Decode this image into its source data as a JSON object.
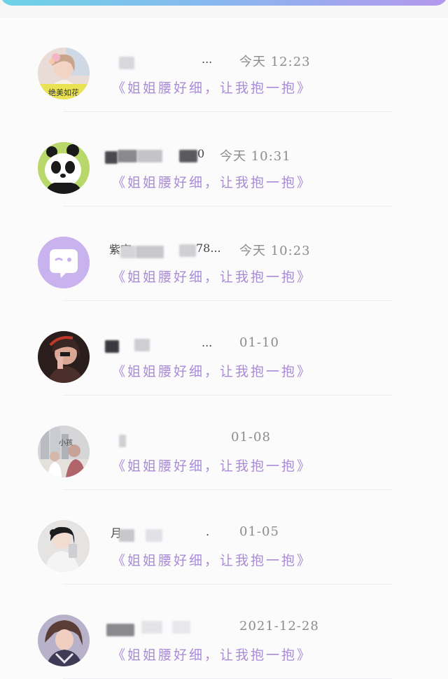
{
  "conversations": [
    {
      "name_fragment": "...",
      "time": "今天 12:23",
      "message": "《姐姐腰好细，让我抱一抱》",
      "avatar": "avatar-girl-flowers",
      "avatar_caption": "绝美如花"
    },
    {
      "name_fragment": "0",
      "time": "今天 10:31",
      "message": "《姐姐腰好细，让我抱一抱》",
      "avatar": "avatar-panda"
    },
    {
      "name_fragment": "紫空",
      "name_fragment_2": "78...",
      "time": "今天 10:23",
      "message": "《姐姐腰好细，让我抱一抱》",
      "avatar": "chat-bubble-icon"
    },
    {
      "name_fragment": "...",
      "time": "01-10",
      "message": "《姐姐腰好细，让我抱一抱》",
      "avatar": "avatar-dark-portrait"
    },
    {
      "name_fragment": "",
      "time": "01-08",
      "message": "《姐姐腰好细，让我抱一抱》",
      "avatar": "avatar-city-couple",
      "avatar_caption": "小孩"
    },
    {
      "name_fragment": "月",
      "name_fragment_2": ".",
      "time": "01-05",
      "message": "《姐姐腰好细，让我抱一抱》",
      "avatar": "avatar-girl-selfie"
    },
    {
      "name_fragment": "",
      "time": "2021-12-28",
      "message": "《姐姐腰好细，让我抱一抱》",
      "avatar": "avatar-illustrated-girl"
    }
  ],
  "colors": {
    "accent_purple": "#a98cd6",
    "time_gray": "#8c8c90",
    "header_gradient_start": "#6dd3e6",
    "header_gradient_end": "#b497ec"
  }
}
